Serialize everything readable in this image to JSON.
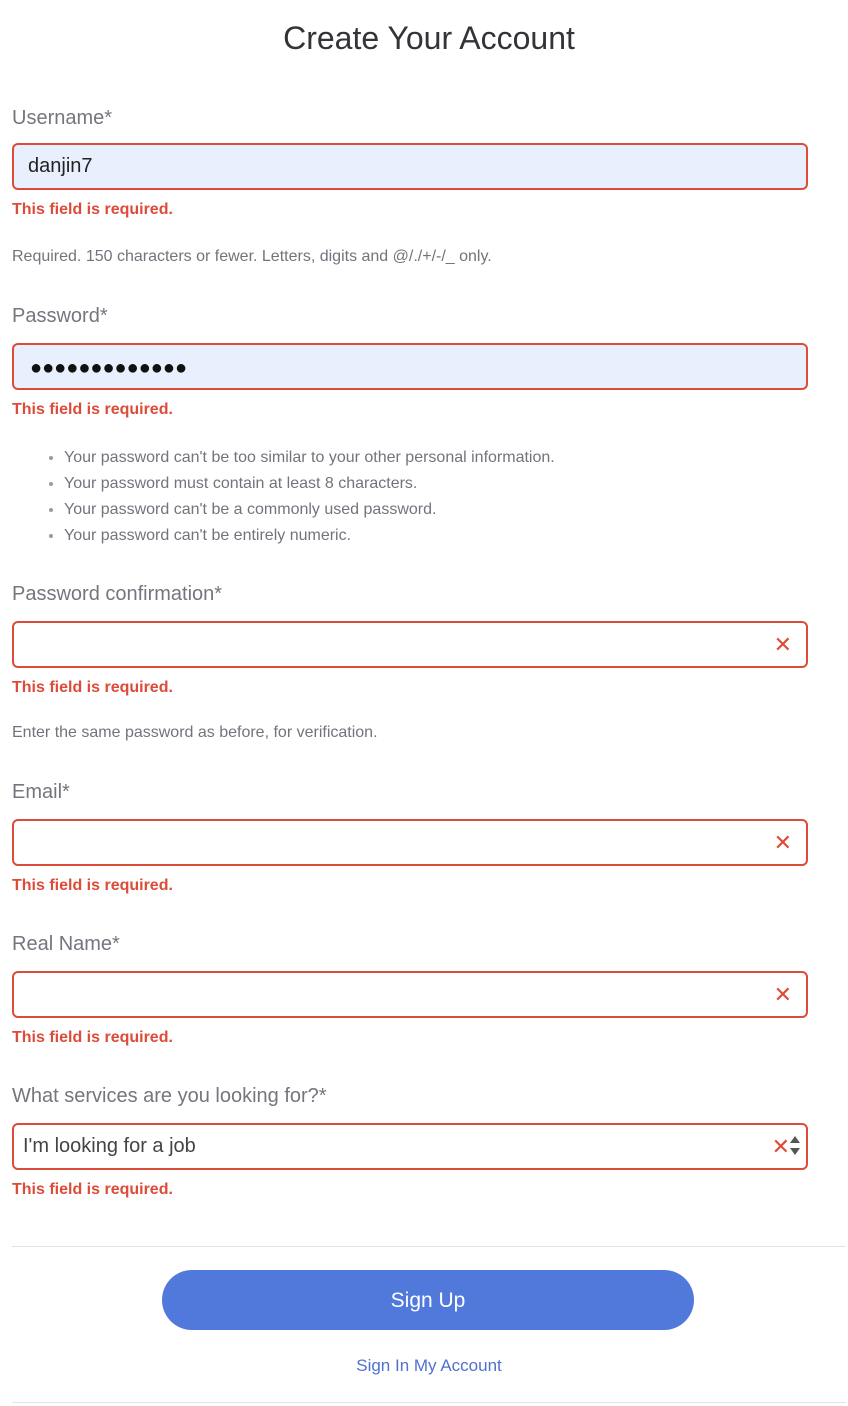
{
  "page": {
    "title": "Create Your Account"
  },
  "form": {
    "username": {
      "label": "Username*",
      "value": "danjin7",
      "error": "This field is required.",
      "help": "Required. 150 characters or fewer. Letters, digits and @/./+/-/_ only."
    },
    "password": {
      "label": "Password*",
      "masked_value": "●●●●●●●●●●●●●",
      "error": "This field is required.",
      "help_items": [
        "Your password can't be too similar to your other personal information.",
        "Your password must contain at least 8 characters.",
        "Your password can't be a commonly used password.",
        "Your password can't be entirely numeric."
      ]
    },
    "password_confirmation": {
      "label": "Password confirmation*",
      "value": "",
      "error": "This field is required.",
      "help": "Enter the same password as before, for verification."
    },
    "email": {
      "label": "Email*",
      "value": "",
      "error": "This field is required."
    },
    "real_name": {
      "label": "Real Name*",
      "value": "",
      "error": "This field is required."
    },
    "services": {
      "label": "What services are you looking for?*",
      "selected": "I'm looking for a job",
      "error": "This field is required."
    },
    "error_icon": "✕"
  },
  "actions": {
    "signup_label": "Sign Up",
    "signin_link": "Sign In My Account"
  },
  "colors": {
    "error": "#dd4b39",
    "primary_button": "#5079db",
    "link": "#4f72cf",
    "autofill_bg": "#e8f0fe"
  }
}
